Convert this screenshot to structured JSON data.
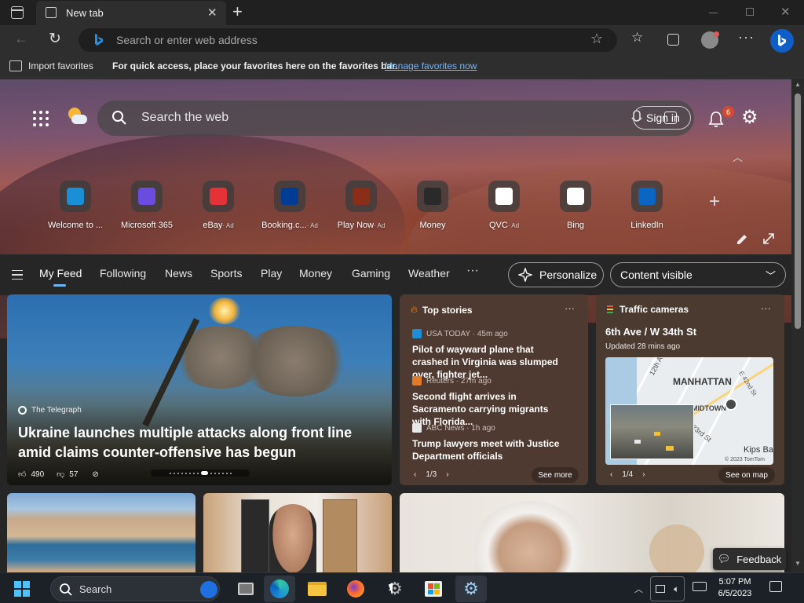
{
  "browser": {
    "tab_title": "New tab",
    "address_placeholder": "Search or enter web address",
    "favorites_bar": {
      "import_label": "Import favorites",
      "message": "For quick access, place your favorites here on the favorites bar.",
      "link": "Manage favorites now"
    }
  },
  "newtab": {
    "search_placeholder": "Search the web",
    "sign_in_label": "Sign in",
    "notification_count": "6",
    "quick_links": [
      {
        "label": "Welcome to ...",
        "ad": "",
        "icon": "edge-icon",
        "color": "#1a8fd6"
      },
      {
        "label": "Microsoft 365",
        "ad": "",
        "icon": "microsoft-365-icon",
        "color": "#6a4ce0"
      },
      {
        "label": "eBay",
        "ad": "· Ad",
        "icon": "ebay-icon",
        "color": "#e53238"
      },
      {
        "label": "Booking.c...",
        "ad": "· Ad",
        "icon": "booking-icon",
        "color": "#003b95"
      },
      {
        "label": "Play Now",
        "ad": "· Ad",
        "icon": "game-icon",
        "color": "#8a2e1a"
      },
      {
        "label": "Money",
        "ad": "",
        "icon": "money-chart-icon",
        "color": "#2a2a2a"
      },
      {
        "label": "QVC",
        "ad": "· Ad",
        "icon": "qvc-icon",
        "color": "#ffffff"
      },
      {
        "label": "Bing",
        "ad": "",
        "icon": "bing-icon",
        "color": "#ffffff"
      },
      {
        "label": "LinkedIn",
        "ad": "",
        "icon": "linkedin-icon",
        "color": "#0a66c2"
      }
    ],
    "feed_tabs": [
      "My Feed",
      "Following",
      "News",
      "Sports",
      "Play",
      "Money",
      "Gaming",
      "Weather"
    ],
    "personalize_label": "Personalize",
    "content_visible_label": "Content visible"
  },
  "hero_card": {
    "source": "The Telegraph",
    "headline": "Ukraine launches multiple attacks along front line amid claims counter-offensive has begun",
    "likes": "490",
    "dislikes": "57"
  },
  "top_stories": {
    "title": "Top stories",
    "pager": "1/3",
    "see_more": "See more",
    "items": [
      {
        "source": "USA TODAY · 45m ago",
        "headline": "Pilot of wayward plane that crashed in Virginia was slumped over, fighter jet...",
        "color": "#1a8fd6"
      },
      {
        "source": "Reuters · 27m ago",
        "headline": "Second flight arrives in Sacramento carrying migrants with Florida...",
        "color": "#e07b2a"
      },
      {
        "source": "ABC News · 1h ago",
        "headline": "Trump lawyers meet with Justice Department officials",
        "color": "#e8e8e8"
      }
    ]
  },
  "traffic": {
    "title": "Traffic cameras",
    "location": "6th Ave / W 34th St",
    "updated": "Updated 28 mins ago",
    "map_labels": [
      "MANHATTAN",
      "12th Ave",
      "E 42nd St",
      "MIDTOWN",
      "23rd St",
      "Kips Ba",
      "© 2023 TomTom"
    ],
    "pager": "1/4",
    "see_on_map": "See on map"
  },
  "feedback_label": "Feedback",
  "taskbar": {
    "search_label": "Search",
    "time": "5:07 PM",
    "date": "6/5/2023"
  }
}
